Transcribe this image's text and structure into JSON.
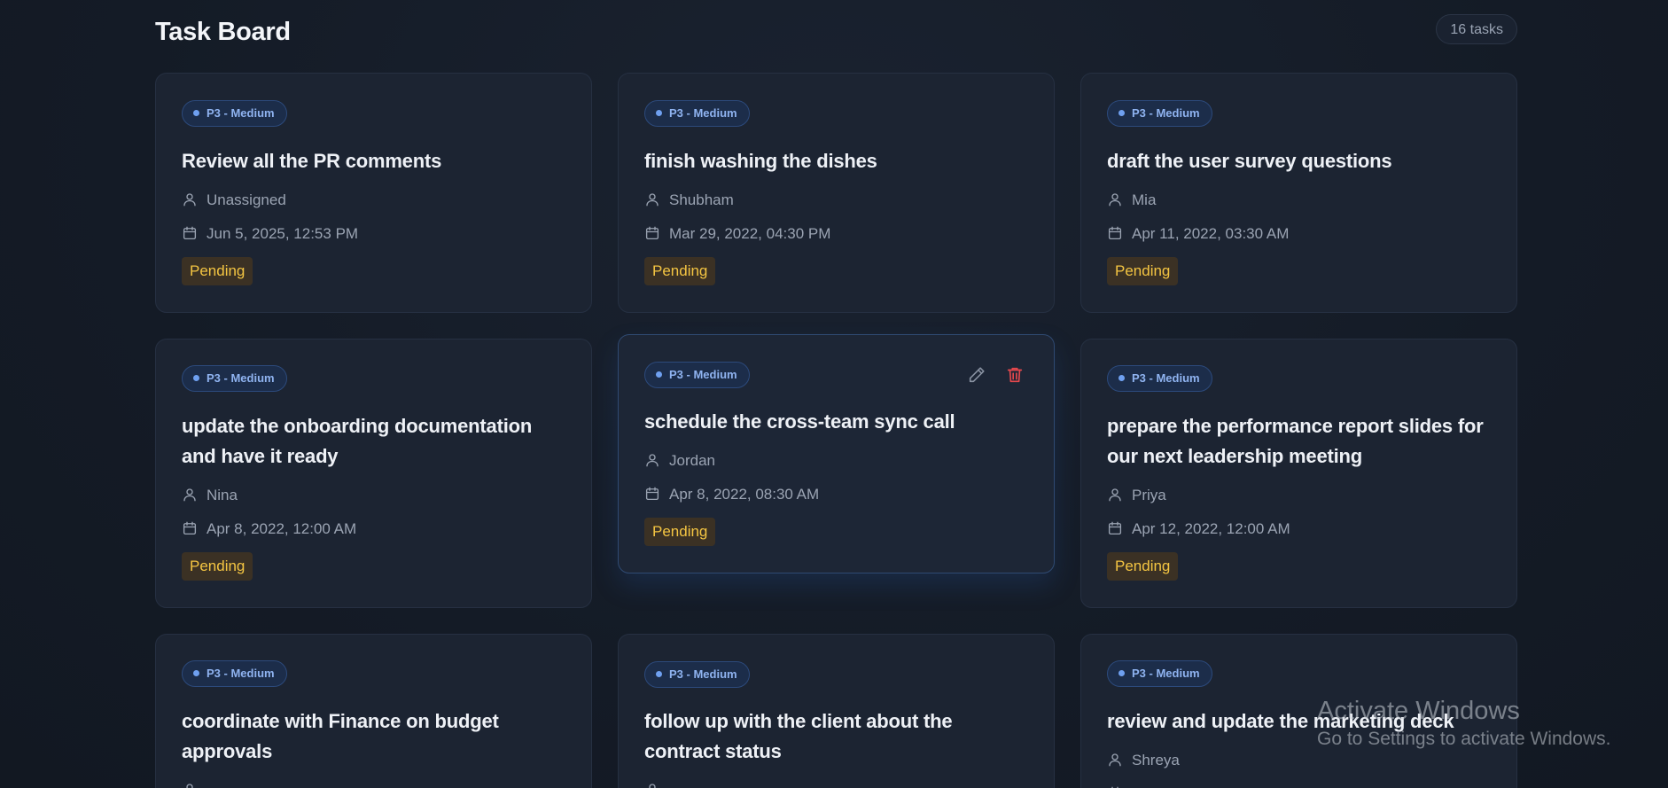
{
  "header": {
    "title": "Task Board",
    "count": "16 tasks"
  },
  "cards": [
    {
      "priority": "P3 - Medium",
      "title": "Review all the PR comments",
      "assignee": "Unassigned",
      "date": "Jun 5, 2025, 12:53 PM",
      "status": "Pending"
    },
    {
      "priority": "P3 - Medium",
      "title": "finish washing the dishes",
      "assignee": "Shubham",
      "date": "Mar 29, 2022, 04:30 PM",
      "status": "Pending"
    },
    {
      "priority": "P3 - Medium",
      "title": "draft the user survey questions",
      "assignee": "Mia",
      "date": "Apr 11, 2022, 03:30 AM",
      "status": "Pending"
    },
    {
      "priority": "P3 - Medium",
      "title": "update the onboarding documentation and have it ready",
      "assignee": "Nina",
      "date": "Apr 8, 2022, 12:00 AM",
      "status": "Pending"
    },
    {
      "priority": "P3 - Medium",
      "title": "schedule the cross-team sync call",
      "assignee": "Jordan",
      "date": "Apr 8, 2022, 08:30 AM",
      "status": "Pending"
    },
    {
      "priority": "P3 - Medium",
      "title": "prepare the performance report slides for our next leadership meeting",
      "assignee": "Priya",
      "date": "Apr 12, 2022, 12:00 AM",
      "status": "Pending"
    },
    {
      "priority": "P3 - Medium",
      "title": "coordinate with Finance on budget approvals",
      "assignee": "",
      "date": "",
      "status": ""
    },
    {
      "priority": "P3 - Medium",
      "title": "follow up with the client about the contract status",
      "assignee": "",
      "date": "",
      "status": ""
    },
    {
      "priority": "P3 - Medium",
      "title": "review and update the marketing deck",
      "assignee": "Shreya",
      "date": "",
      "status": ""
    }
  ],
  "icons": {
    "assignee": "user-icon",
    "date": "calendar-icon",
    "edit": "pencil-icon",
    "delete": "trash-icon"
  },
  "colors": {
    "priority_badge": "#8fb3f0",
    "status_pending": "#f4c542",
    "delete_action": "#e5484d"
  },
  "watermark": {
    "line1": "Activate Windows",
    "line2": "Go to Settings to activate Windows."
  }
}
